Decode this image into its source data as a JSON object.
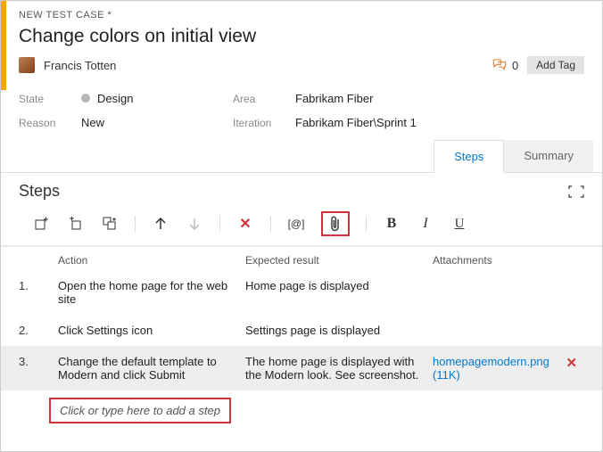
{
  "header": {
    "new_label": "NEW TEST CASE *",
    "title": "Change colors on initial view",
    "assignee": "Francis Totten",
    "discussion_count": "0",
    "add_tag": "Add Tag"
  },
  "fields": {
    "state_label": "State",
    "state_value": "Design",
    "reason_label": "Reason",
    "reason_value": "New",
    "area_label": "Area",
    "area_value": "Fabrikam Fiber",
    "iteration_label": "Iteration",
    "iteration_value": "Fabrikam Fiber\\Sprint 1"
  },
  "tabs": {
    "steps": "Steps",
    "summary": "Summary"
  },
  "steps_section": {
    "heading": "Steps",
    "columns": {
      "action": "Action",
      "expected": "Expected result",
      "attachments": "Attachments"
    },
    "rows": [
      {
        "num": "1.",
        "action": "Open the home page for the web site",
        "expected": "Home page is displayed",
        "attachment": ""
      },
      {
        "num": "2.",
        "action": "Click Settings icon",
        "expected": "Settings page is displayed",
        "attachment": ""
      },
      {
        "num": "3.",
        "action": "Change the default template to Modern and click Submit",
        "expected": "The home page is displayed with the Modern look. See screenshot.",
        "attachment": "homepagemodern.png (11K)"
      }
    ],
    "add_step_placeholder": "Click or type here to add a step"
  },
  "toolbar": {
    "param_label": "[@]"
  }
}
